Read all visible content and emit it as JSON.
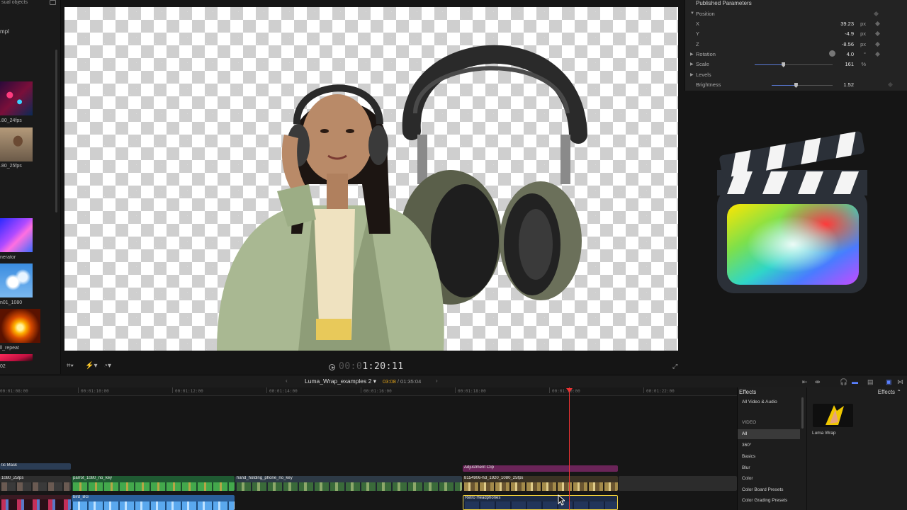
{
  "browser": {
    "header": "sual objects",
    "partial_label": "mpl",
    "thumbnails": [
      {
        "label": ".80_24fps"
      },
      {
        "label": ".80_25fps"
      },
      {
        "label": "nerator"
      },
      {
        "label": "n01_1080"
      },
      {
        "label": "ll_repeat"
      },
      {
        "label": ""
      }
    ]
  },
  "viewer": {
    "timecode_dim": "00:0",
    "timecode": "1:20:11"
  },
  "inspector": {
    "title": "Published Parameters",
    "rows": [
      {
        "label": "Position"
      },
      {
        "label": "X",
        "value": "39.23",
        "unit": "px"
      },
      {
        "label": "Y",
        "value": "-4.9",
        "unit": "px"
      },
      {
        "label": "Z",
        "value": "-8.56",
        "unit": "px"
      },
      {
        "label": "Rotation",
        "value": "4.0",
        "unit": "°"
      },
      {
        "label": "Scale",
        "value": "161",
        "unit": "%",
        "slider": 0.37
      },
      {
        "label": "Levels"
      },
      {
        "label": "Brightness",
        "value": "1.52",
        "slider": 0.4
      }
    ]
  },
  "timeline": {
    "project_name": "Luma_Wrap_examples 2",
    "current": "03:08",
    "total": "01:35:04",
    "ruler": [
      "00:01:08:00",
      "00:01:10:00",
      "00:01:12:00",
      "00:01:14:00",
      "00:01:16:00",
      "00:01:18:00",
      "00:01:20:00",
      "00:01:22:00"
    ],
    "left_edge_num": "02",
    "clips": {
      "mask": "tic Mask",
      "left_clip": "1080_25fps",
      "parrot": "parrot_1080_no_key",
      "hand": "hand_holding_phone_no_key",
      "stock": "8154906-hd_1920_1080_25fps",
      "adjustment": "Adjustment Clip",
      "bird": "bird_BG",
      "retro": "Retro Headphones"
    }
  },
  "effects": {
    "title": "Effects",
    "dropdown": "Effects",
    "categories": [
      {
        "label": "All Video & Audio",
        "type": "item"
      },
      {
        "label": "VIDEO",
        "type": "section"
      },
      {
        "label": "All",
        "type": "selected"
      },
      {
        "label": "360°",
        "type": "item"
      },
      {
        "label": "Basics",
        "type": "item"
      },
      {
        "label": "Blur",
        "type": "item"
      },
      {
        "label": "Color",
        "type": "item"
      },
      {
        "label": "Color Board Presets",
        "type": "item"
      },
      {
        "label": "Color Grading Presets",
        "type": "item"
      }
    ],
    "thumb_label": "Luma Wrap"
  },
  "colors": {
    "accent": "#5a80ff",
    "playhead": "#ee3333",
    "selection": "#f2d23a",
    "timecode_current": "#e0a31a"
  }
}
